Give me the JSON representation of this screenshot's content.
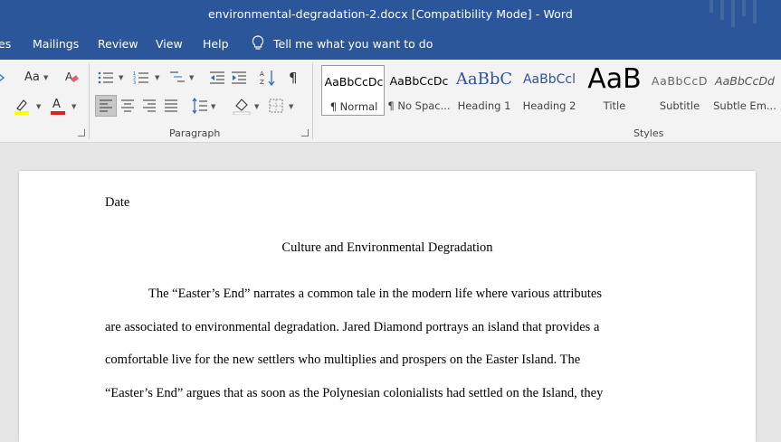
{
  "window": {
    "title": "environmental-degradation-2.docx [Compatibility Mode]  -  Word"
  },
  "menu": {
    "tabs": [
      "es",
      "Mailings",
      "Review",
      "View",
      "Help"
    ],
    "tell_me": "Tell me what you want to do"
  },
  "ribbon": {
    "groups": {
      "paragraph": "Paragraph",
      "styles": "Styles"
    },
    "font_glyphs": {
      "change_case": "Aa",
      "font_color": "A"
    },
    "styles": [
      {
        "preview": "AaBbCcDc",
        "name": "¶ Normal"
      },
      {
        "preview": "AaBbCcDc",
        "name": "¶ No Spac..."
      },
      {
        "preview": "AaBbC",
        "name": "Heading 1"
      },
      {
        "preview": "AaBbCcl",
        "name": "Heading 2"
      },
      {
        "preview": "AaB",
        "name": "Title"
      },
      {
        "preview": "AaBbCcD",
        "name": "Subtitle"
      },
      {
        "preview": "AaBbCcDd",
        "name": "Subtle Em..."
      }
    ]
  },
  "document": {
    "date_line": "Date",
    "heading": "Culture and Environmental Degradation",
    "lines": [
      "The “Easter’s End” narrates a common tale in the modern life where various attributes",
      "are associated to environmental degradation. Jared Diamond portrays an island that provides a",
      "comfortable live for the new settlers who multiplies and prospers on the Easter Island. The",
      "“Easter’s End” argues that as soon as the Polynesian colonialists had settled on the Island, they"
    ]
  },
  "colors": {
    "titlebar": "#2b579a",
    "ribbon": "#f3f3f3",
    "workspace": "#e6e6e6",
    "highlight_yellow": "#ffff00",
    "font_color_red": "#e02020"
  }
}
